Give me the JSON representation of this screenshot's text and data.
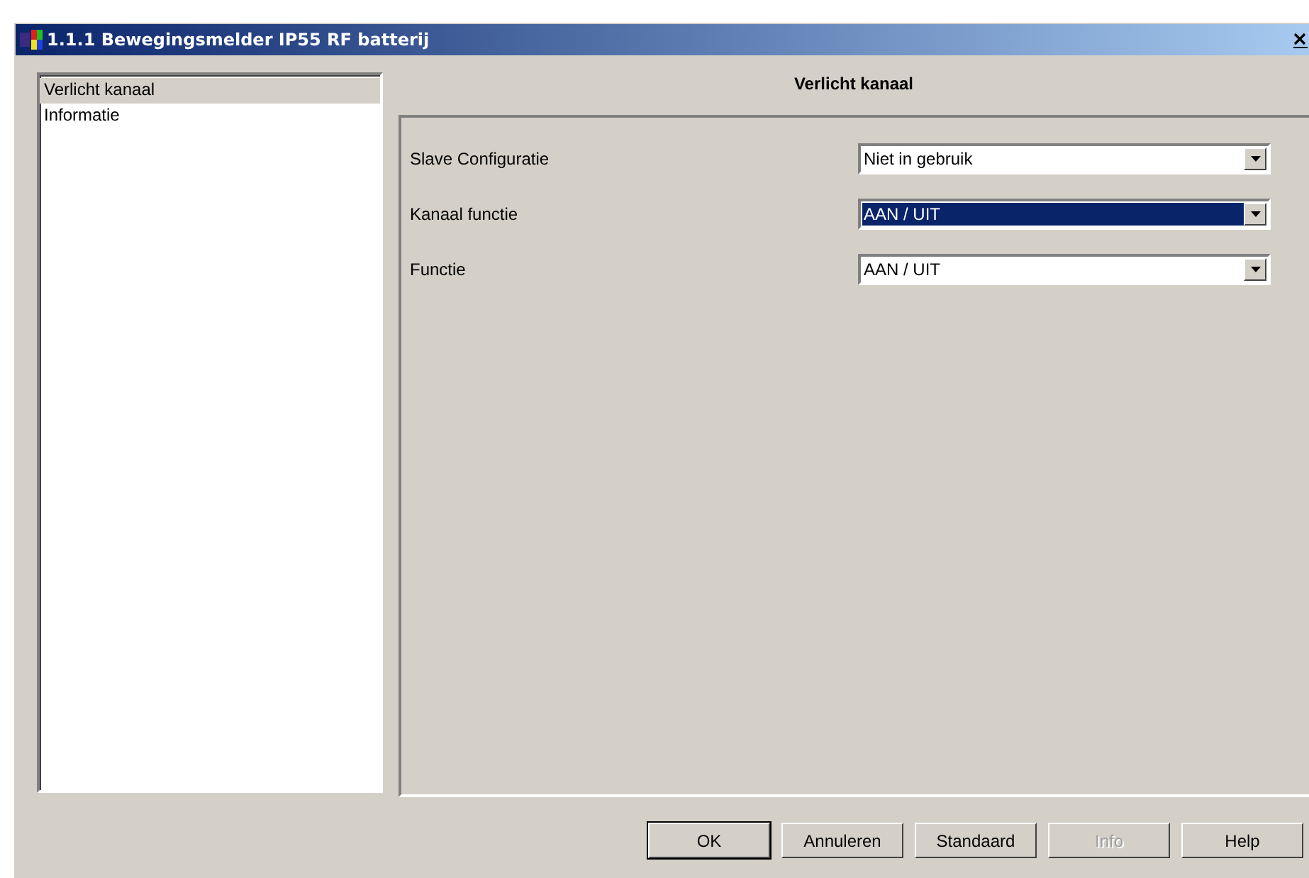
{
  "window": {
    "title": "1.1.1 Bewegingsmelder IP55 RF batterij"
  },
  "sidebar": {
    "items": [
      {
        "label": "Verlicht kanaal",
        "selected": true
      },
      {
        "label": "Informatie",
        "selected": false
      }
    ]
  },
  "panel": {
    "heading": "Verlicht kanaal",
    "rows": [
      {
        "label": "Slave Configuratie",
        "value": "Niet in gebruik",
        "focused": false
      },
      {
        "label": "Kanaal functie",
        "value": "AAN / UIT",
        "focused": true
      },
      {
        "label": "Functie",
        "value": "AAN / UIT",
        "focused": false
      }
    ]
  },
  "buttons": [
    {
      "label": "OK",
      "default": true,
      "disabled": false
    },
    {
      "label": "Annuleren",
      "default": false,
      "disabled": false
    },
    {
      "label": "Standaard",
      "default": false,
      "disabled": false
    },
    {
      "label": "Info",
      "default": false,
      "disabled": true
    },
    {
      "label": "Help",
      "default": false,
      "disabled": false
    }
  ]
}
